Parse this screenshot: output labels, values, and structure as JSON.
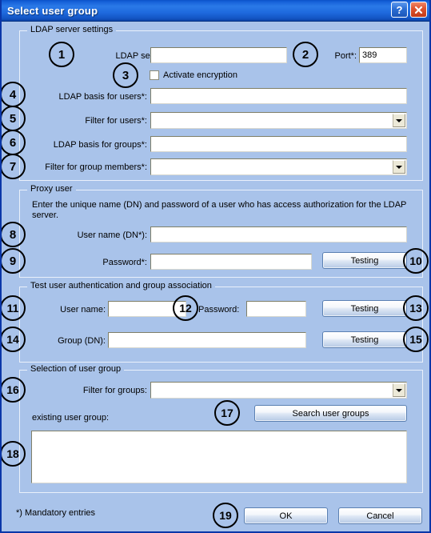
{
  "window": {
    "title": "Select user group",
    "help_button": "?",
    "close_button": "✕"
  },
  "groups": {
    "ldap_server_settings": {
      "legend": "LDAP server settings",
      "fields": {
        "ldap_server_label": "LDAP server*:",
        "ldap_server_value": "",
        "port_label": "Port*:",
        "port_value": "389",
        "activate_encryption_label": "Activate encryption",
        "activate_encryption_checked": false,
        "ldap_basis_users_label": "LDAP basis for users*:",
        "ldap_basis_users_value": "",
        "filter_users_label": "Filter for users*:",
        "filter_users_value": "",
        "ldap_basis_groups_label": "LDAP basis for groups*:",
        "ldap_basis_groups_value": "",
        "filter_group_members_label": "Filter for group members*:",
        "filter_group_members_value": ""
      }
    },
    "proxy_user": {
      "legend": "Proxy user",
      "description": "Enter the unique name (DN) and password of a user who has access authorization for the LDAP server.",
      "fields": {
        "user_name_label": "User name (DN*):",
        "user_name_value": "",
        "password_label": "Password*:",
        "password_value": "",
        "test_button": "Testing"
      }
    },
    "test_auth": {
      "legend": "Test user authentication and group association",
      "fields": {
        "user_name_label": "User name:",
        "user_name_value": "",
        "password_label": "Password:",
        "password_value": "",
        "test_button_1": "Testing",
        "group_dn_label": "Group (DN):",
        "group_dn_value": "",
        "test_button_2": "Testing"
      }
    },
    "selection_user_group": {
      "legend": "Selection of user group",
      "fields": {
        "filter_groups_label": "Filter for groups:",
        "filter_groups_value": "",
        "search_button": "Search user groups",
        "existing_user_group_label": "existing user group:",
        "existing_user_group_items": []
      }
    }
  },
  "footer": {
    "mandatory_note": "*) Mandatory entries",
    "ok_button": "OK",
    "cancel_button": "Cancel"
  },
  "callouts": {
    "c1": "1",
    "c2": "2",
    "c3": "3",
    "c4": "4",
    "c5": "5",
    "c6": "6",
    "c7": "7",
    "c8": "8",
    "c9": "9",
    "c10": "10",
    "c11": "11",
    "c12": "12",
    "c13": "13",
    "c14": "14",
    "c15": "15",
    "c16": "16",
    "c17": "17",
    "c18": "18",
    "c19": "19"
  },
  "colors": {
    "dialog_background": "#a9c3ea",
    "title_bar": "#1560d8",
    "dialog_border": "#0a36a8",
    "field_background": "#ffffff",
    "close_button": "#e05530"
  }
}
